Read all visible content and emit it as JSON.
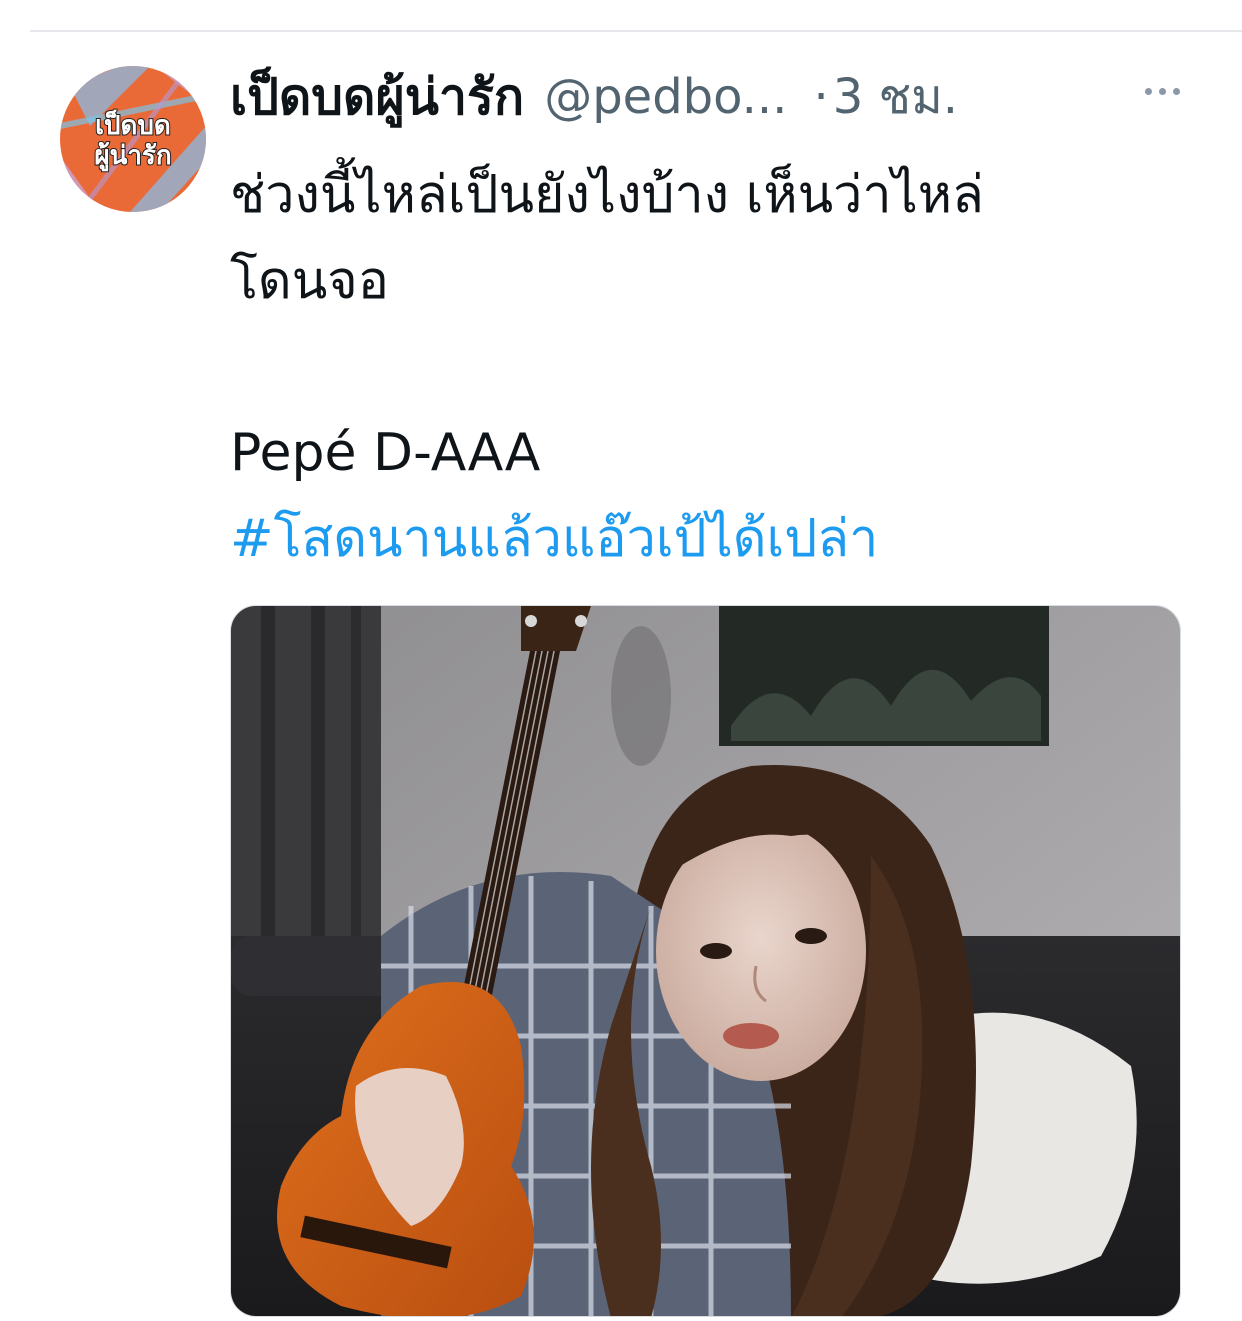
{
  "tweet": {
    "author": {
      "display_name": "เป็ดบดผู้น่ารัก",
      "handle": "@pedbo...",
      "avatar_text_line1": "เป็ดบด",
      "avatar_text_line2": "ผู้น่ารัก"
    },
    "separator": "·",
    "time": "3 ชม.",
    "more_icon": "more-horizontal-icon",
    "text_lines": [
      "ช่วงนี้ไหล่เป็นยังไงบ้าง เห็นว่าไหล่",
      "โดนจอ",
      "",
      "Pepé D-AAA"
    ],
    "hashtag": "#โสดนานแล้วแอ๊วเป้ได้เปล่า",
    "media_alt": "woman with long brown hair holding an orange acoustic guitar, leaning on a white pillow"
  },
  "colors": {
    "text_primary": "#0f1419",
    "text_secondary": "#536471",
    "link": "#1d9bf0",
    "avatar_bg": "#ea6a37",
    "divider": "#e5e7eb"
  }
}
